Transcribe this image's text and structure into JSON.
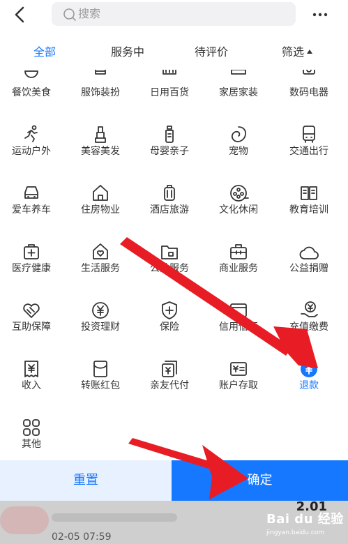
{
  "search": {
    "placeholder": "搜索"
  },
  "tabs": [
    {
      "label": "全部",
      "active": true
    },
    {
      "label": "服务中",
      "active": false
    },
    {
      "label": "待评价",
      "active": false
    },
    {
      "label": "筛选",
      "active": false
    }
  ],
  "categories": [
    {
      "label": "餐饮美食",
      "icon": "bowl-icon"
    },
    {
      "label": "服饰装扮",
      "icon": "clothes-icon"
    },
    {
      "label": "日用百货",
      "icon": "basket-icon"
    },
    {
      "label": "家居家装",
      "icon": "sofa-icon"
    },
    {
      "label": "数码电器",
      "icon": "camera-icon"
    },
    {
      "label": "运动户外",
      "icon": "runner-icon"
    },
    {
      "label": "美容美发",
      "icon": "lipstick-icon"
    },
    {
      "label": "母婴亲子",
      "icon": "baby-bottle-icon"
    },
    {
      "label": "宠物",
      "icon": "pet-icon"
    },
    {
      "label": "交通出行",
      "icon": "bus-icon"
    },
    {
      "label": "爱车养车",
      "icon": "car-icon"
    },
    {
      "label": "住房物业",
      "icon": "house-icon"
    },
    {
      "label": "酒店旅游",
      "icon": "luggage-icon"
    },
    {
      "label": "文化休闲",
      "icon": "film-reel-icon"
    },
    {
      "label": "教育培训",
      "icon": "book-icon"
    },
    {
      "label": "医疗健康",
      "icon": "medical-kit-icon"
    },
    {
      "label": "生活服务",
      "icon": "home-heart-icon"
    },
    {
      "label": "公共服务",
      "icon": "folder-icon"
    },
    {
      "label": "商业服务",
      "icon": "briefcase-icon"
    },
    {
      "label": "公益捐赠",
      "icon": "heart-cloud-icon"
    },
    {
      "label": "互助保障",
      "icon": "handshake-heart-icon"
    },
    {
      "label": "投资理财",
      "icon": "yuan-circle-icon"
    },
    {
      "label": "保险",
      "icon": "shield-plus-icon"
    },
    {
      "label": "信用借还",
      "icon": "card-icon"
    },
    {
      "label": "充值缴费",
      "icon": "hand-coin-icon"
    },
    {
      "label": "收入",
      "icon": "yuan-receipt-icon"
    },
    {
      "label": "转账红包",
      "icon": "red-envelope-icon"
    },
    {
      "label": "亲友代付",
      "icon": "cards-yuan-icon"
    },
    {
      "label": "账户存取",
      "icon": "wallet-yuan-icon"
    },
    {
      "label": "退款",
      "icon": "refund-icon",
      "selected": true
    },
    {
      "label": "其他",
      "icon": "grid-icon"
    }
  ],
  "buttons": {
    "reset": "重置",
    "confirm": "确定"
  },
  "background_list": {
    "amount": "2.01",
    "datetime": "02-05  07:59"
  },
  "watermark": {
    "logo": "Bai du 经验",
    "url": "jingyan.baidu.com"
  },
  "colors": {
    "accent": "#1677ff",
    "arrow": "#e81c24"
  }
}
